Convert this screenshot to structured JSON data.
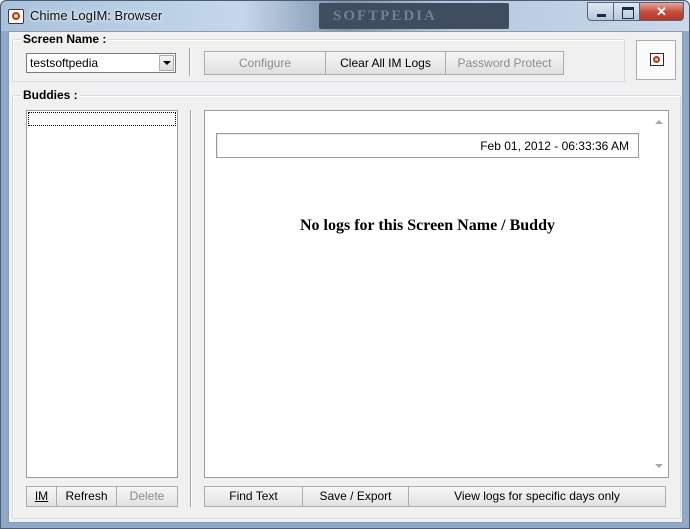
{
  "window": {
    "title": "Chime LogIM: Browser",
    "watermark": "SOFTPEDIA",
    "close_glyph": "✕"
  },
  "screen_name": {
    "label": "Screen Name :",
    "selected": "testsoftpedia"
  },
  "toolbar": {
    "configure": "Configure",
    "clear_all": "Clear All IM Logs",
    "password_protect": "Password Protect"
  },
  "buddies": {
    "label": "Buddies :",
    "items": []
  },
  "log": {
    "date": "Feb 01, 2012 - 06:33:36 AM",
    "message": "No logs for this Screen Name / Buddy"
  },
  "buddy_actions": {
    "im": "IM",
    "refresh": "Refresh",
    "delete": "Delete"
  },
  "log_actions": {
    "find_text": "Find Text",
    "save_export": "Save / Export",
    "view_days": "View logs for specific days only"
  },
  "icons": {
    "app": "chime-app-icon",
    "screenname_action": "chime-icon-button"
  }
}
